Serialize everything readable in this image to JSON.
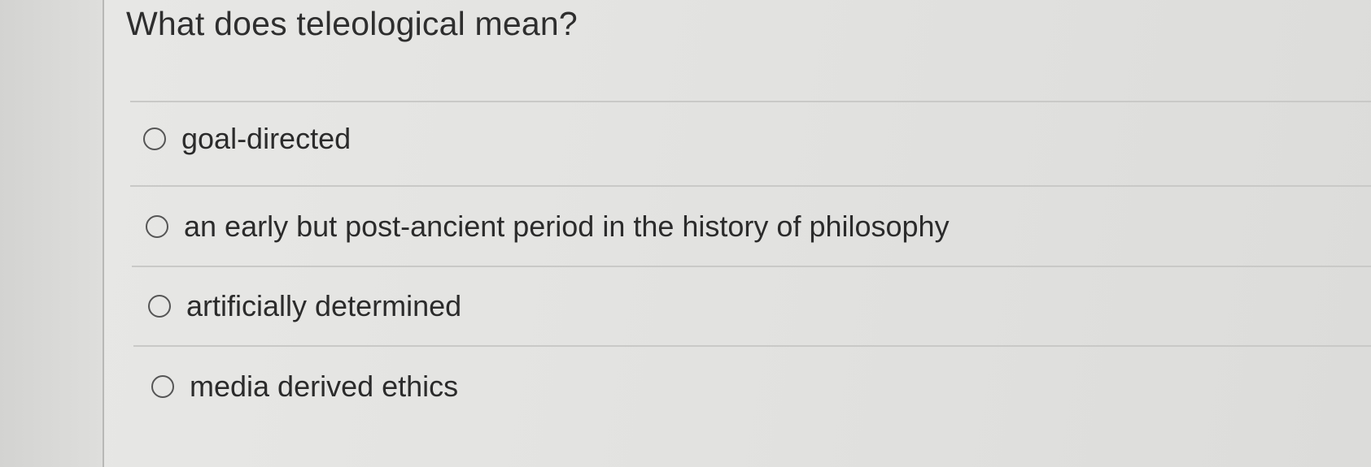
{
  "question": {
    "text": "What does teleological mean?"
  },
  "options": [
    {
      "label": "goal-directed",
      "selected": false
    },
    {
      "label": "an early but post-ancient period in the history of philosophy",
      "selected": false
    },
    {
      "label": "artificially determined",
      "selected": false
    },
    {
      "label": "media derived ethics",
      "selected": false
    }
  ]
}
